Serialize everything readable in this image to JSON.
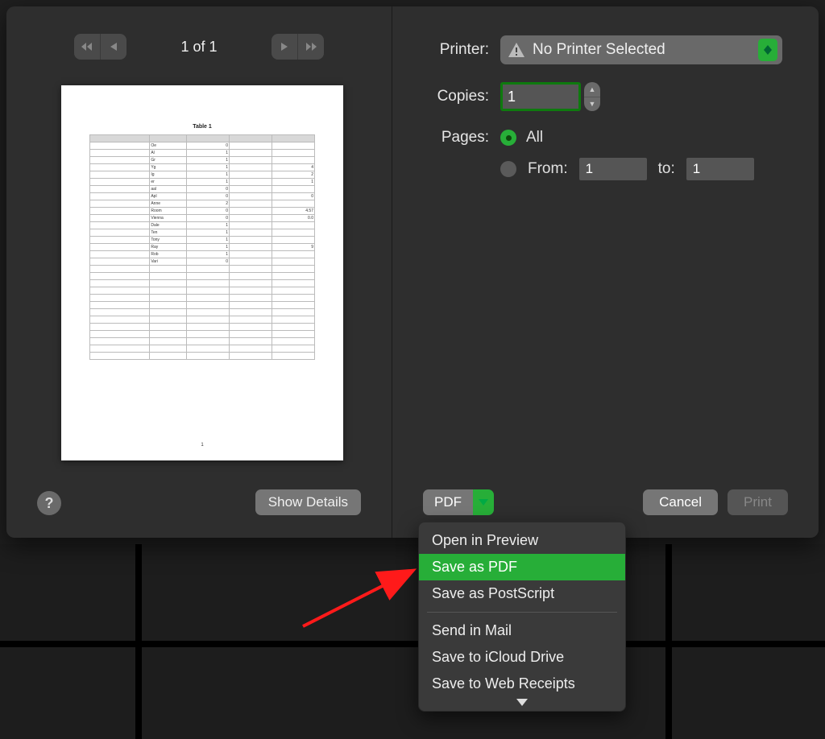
{
  "nav": {
    "page_indicator": "1 of 1"
  },
  "preview": {
    "table_title": "Table 1",
    "page_number": "1",
    "rows": [
      {
        "name": "Oe",
        "a": "0",
        "b": "",
        "c": ""
      },
      {
        "name": "Al",
        "a": "1",
        "b": "",
        "c": ""
      },
      {
        "name": "Gr",
        "a": "1",
        "b": "",
        "c": ""
      },
      {
        "name": "Yg",
        "a": "1",
        "b": "",
        "c": "4"
      },
      {
        "name": "Ig",
        "a": "1",
        "b": "",
        "c": "2"
      },
      {
        "name": "er",
        "a": "1",
        "b": "",
        "c": "1"
      },
      {
        "name": "aal",
        "a": "0",
        "b": "",
        "c": ""
      },
      {
        "name": "Apl",
        "a": "0",
        "b": "",
        "c": "0"
      },
      {
        "name": "Anne",
        "a": "2",
        "b": "",
        "c": ""
      },
      {
        "name": "Room",
        "a": "0",
        "b": "",
        "c": "4.57"
      },
      {
        "name": "Vienna",
        "a": "0",
        "b": "",
        "c": "0.0"
      },
      {
        "name": "Dale",
        "a": "1",
        "b": "",
        "c": ""
      },
      {
        "name": "Ten",
        "a": "1",
        "b": "",
        "c": ""
      },
      {
        "name": "Tony",
        "a": "1",
        "b": "",
        "c": ""
      },
      {
        "name": "Ray",
        "a": "1",
        "b": "",
        "c": "9"
      },
      {
        "name": "Rob",
        "a": "1",
        "b": "",
        "c": ""
      },
      {
        "name": "Vari",
        "a": "0",
        "b": "",
        "c": ""
      }
    ]
  },
  "labels": {
    "printer": "Printer:",
    "copies": "Copies:",
    "pages": "Pages:",
    "all": "All",
    "from": "From:",
    "to": "to:",
    "show_details": "Show Details",
    "pdf": "PDF",
    "cancel": "Cancel",
    "print": "Print",
    "help": "?"
  },
  "values": {
    "printer_selected": "No Printer Selected",
    "copies": "1",
    "page_from": "1",
    "page_to": "1"
  },
  "menu": {
    "items": [
      "Open in Preview",
      "Save as PDF",
      "Save as PostScript",
      "Send in Mail",
      "Save to iCloud Drive",
      "Save to Web Receipts"
    ],
    "highlighted_index": 1,
    "separator_after_index": 2
  }
}
